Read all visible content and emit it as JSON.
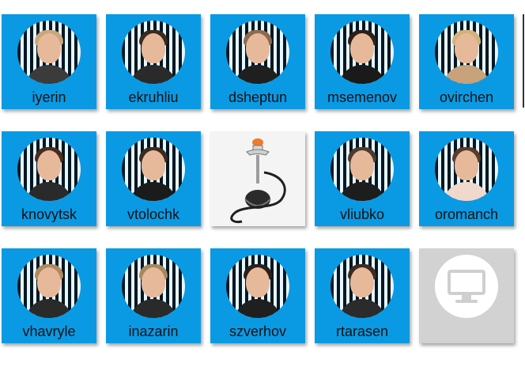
{
  "colors": {
    "accent": "#0a9ae3",
    "device": "#d2d2d2"
  },
  "tiles": [
    {
      "kind": "user",
      "label": "iyerin",
      "hair": "#c9a77c",
      "body": "#3b3b3b"
    },
    {
      "kind": "user",
      "label": "ekruhliu",
      "hair": "#3a2a1f",
      "body": "#2a2a2a"
    },
    {
      "kind": "user",
      "label": "dsheptun",
      "hair": "#8b6a4d",
      "body": "#1f1f1f"
    },
    {
      "kind": "user",
      "label": "msemenov",
      "hair": "#2a2019",
      "body": "#1a1a1a"
    },
    {
      "kind": "user",
      "label": "ovirchen",
      "hair": "#d3b27a",
      "body": "#c7a27a"
    },
    {
      "kind": "user",
      "label": "knovytsk",
      "hair": "#4a2c1f",
      "body": "#2a2a2a"
    },
    {
      "kind": "user",
      "label": "vtolochk",
      "hair": "#3b2a1f",
      "body": "#1b1b1b"
    },
    {
      "kind": "image",
      "label": "",
      "icon": "hookah-image"
    },
    {
      "kind": "user",
      "label": "vliubko",
      "hair": "#4b3a2f",
      "body": "#1d1d1d"
    },
    {
      "kind": "user",
      "label": "oromanch",
      "hair": "#5a3a2a",
      "body": "#f0d9cc"
    },
    {
      "kind": "user",
      "label": "vhavryle",
      "hair": "#b08a5b",
      "body": "#2a2a2a"
    },
    {
      "kind": "user",
      "label": "inazarin",
      "hair": "#a6875f",
      "body": "#2a2a2a"
    },
    {
      "kind": "user",
      "label": "szverhov",
      "hair": "#2a1f18",
      "body": "#1f1f1f"
    },
    {
      "kind": "user",
      "label": "rtarasen",
      "hair": "#3a2b22",
      "body": "#2b2b2b"
    },
    {
      "kind": "device",
      "label": "",
      "icon": "monitor-icon"
    }
  ]
}
